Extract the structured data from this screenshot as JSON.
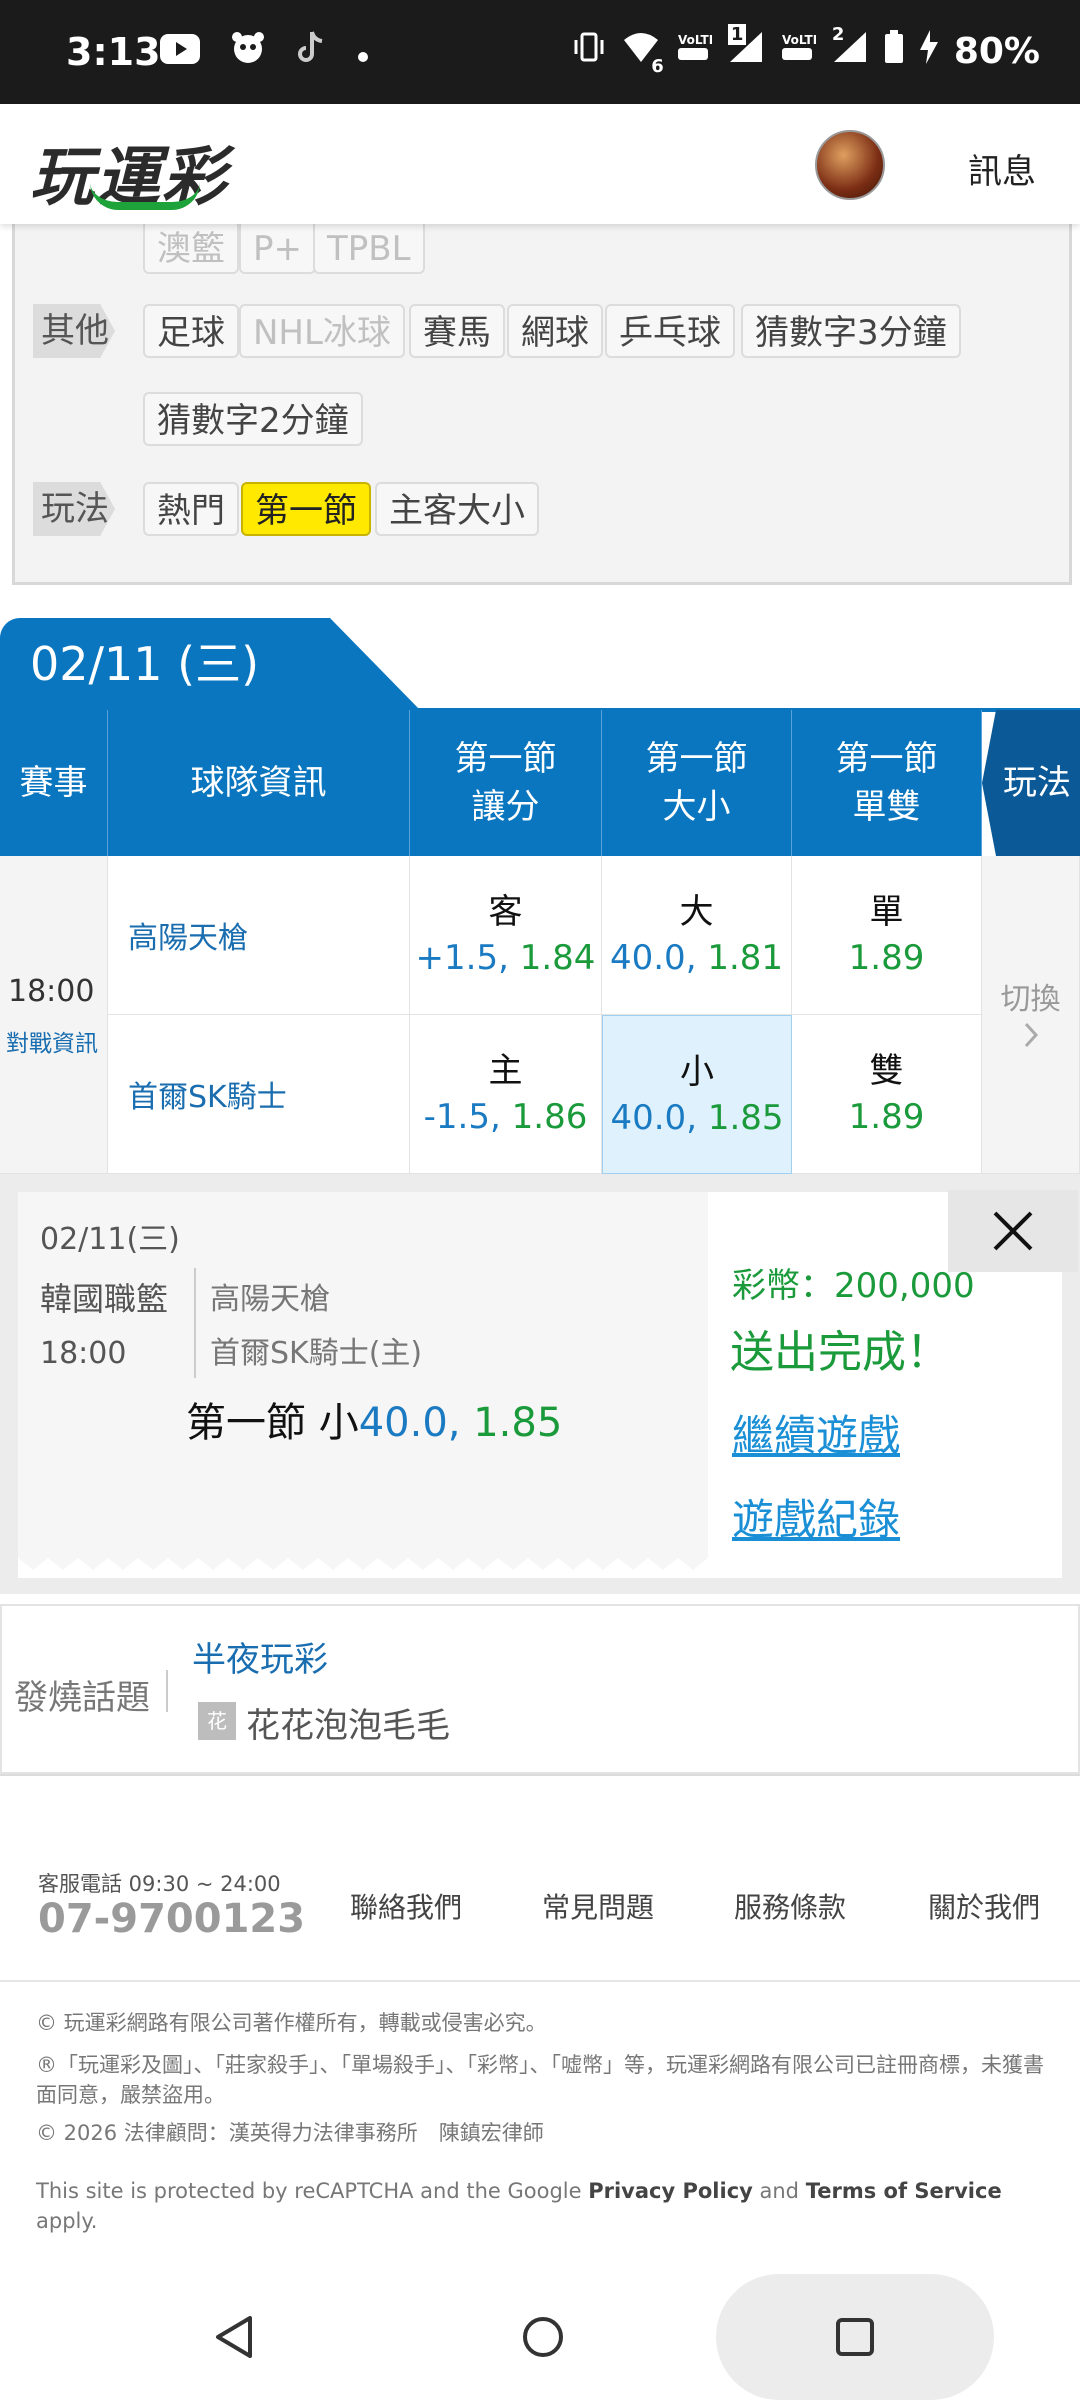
{
  "status_bar": {
    "time": "3:13",
    "left_icons": [
      "youtube-icon",
      "panda-icon",
      "tiktok-icon",
      "dot-icon"
    ],
    "right_icons": [
      "vibrate-icon",
      "wifi-icon",
      "volte-icon",
      "signal-icon",
      "battery-icon",
      "charging-icon"
    ],
    "wifi_badge": "6",
    "sim1_badge": "1",
    "sim2_badge": "2",
    "battery": "80%"
  },
  "header": {
    "logo_text": "玩運彩",
    "messages_label": "訊息"
  },
  "filters": {
    "partial_row": [
      "澳籃",
      "P+",
      "TPBL"
    ],
    "other_label": "其他",
    "other_chips": [
      "足球",
      "NHL冰球",
      "賽馬",
      "網球",
      "乒乓球",
      "猜數字3分鐘",
      "猜數字2分鐘"
    ],
    "play_label": "玩法",
    "play_chips": [
      "熱門",
      "第一節",
      "主客大小"
    ],
    "active_play": "第一節"
  },
  "schedule": {
    "date_tab": "02/11 (三)",
    "headers": {
      "event": "賽事",
      "team_info": "球隊資訊",
      "spread_l1": "第一節",
      "spread_l2": "讓分",
      "total_l1": "第一節",
      "total_l2": "大小",
      "oddeven_l1": "第一節",
      "oddeven_l2": "單雙",
      "play": "玩法"
    },
    "game": {
      "time": "18:00",
      "matchup_link": "對戰資訊",
      "switch_label": "切換",
      "rows": [
        {
          "team": "高陽天槍",
          "spread_label": "客",
          "spread_value": "+1.5,",
          "spread_odds": "1.84",
          "total_label": "大",
          "total_value": "40.0,",
          "total_odds": "1.81",
          "oe_label": "單",
          "oe_odds": "1.89"
        },
        {
          "team": "首爾SK騎士",
          "spread_label": "主",
          "spread_value": "-1.5,",
          "spread_odds": "1.86",
          "total_label": "小",
          "total_value": "40.0,",
          "total_odds": "1.85",
          "oe_label": "雙",
          "oe_odds": "1.89"
        }
      ]
    }
  },
  "bet_confirm": {
    "date": "02/11(三)",
    "league": "韓國職籃",
    "time": "18:00",
    "team_away": "高陽天槍",
    "team_home": "首爾SK騎士(主)",
    "bet_prefix": "第一節 小",
    "bet_value": "40.0,",
    "bet_odds": "1.85",
    "coins_label": "彩幣：200,000",
    "success_text": "送出完成！",
    "continue_link": "繼續遊戲",
    "history_link": "遊戲紀錄"
  },
  "hot_topics": {
    "label": "發燒話題",
    "title": "半夜玩彩",
    "author_badge": "花",
    "author": "花花泡泡毛毛"
  },
  "footer": {
    "hotline_label": "客服電話 09:30 ~ 24:00",
    "hotline_number": "07-9700123",
    "nav": [
      "聯絡我們",
      "常見問題",
      "服務條款",
      "關於我們"
    ],
    "copyright": "© 玩運彩網路有限公司著作權所有，轉載或侵害必究。",
    "trademark": "®「玩運彩及圖」、「莊家殺手」、「單場殺手」、「彩幣」、「嘘幣」等，玩運彩網路有限公司已註冊商標，未獲書面同意，嚴禁盜用。",
    "legal": "© 2026 法律顧問：漢英得力法律事務所　陳鎮宏律師",
    "recaptcha_pre": "This site is protected by reCAPTCHA and the Google ",
    "privacy": "Privacy Policy",
    "and": " and ",
    "terms": "Terms of Service",
    "apply": " apply."
  }
}
